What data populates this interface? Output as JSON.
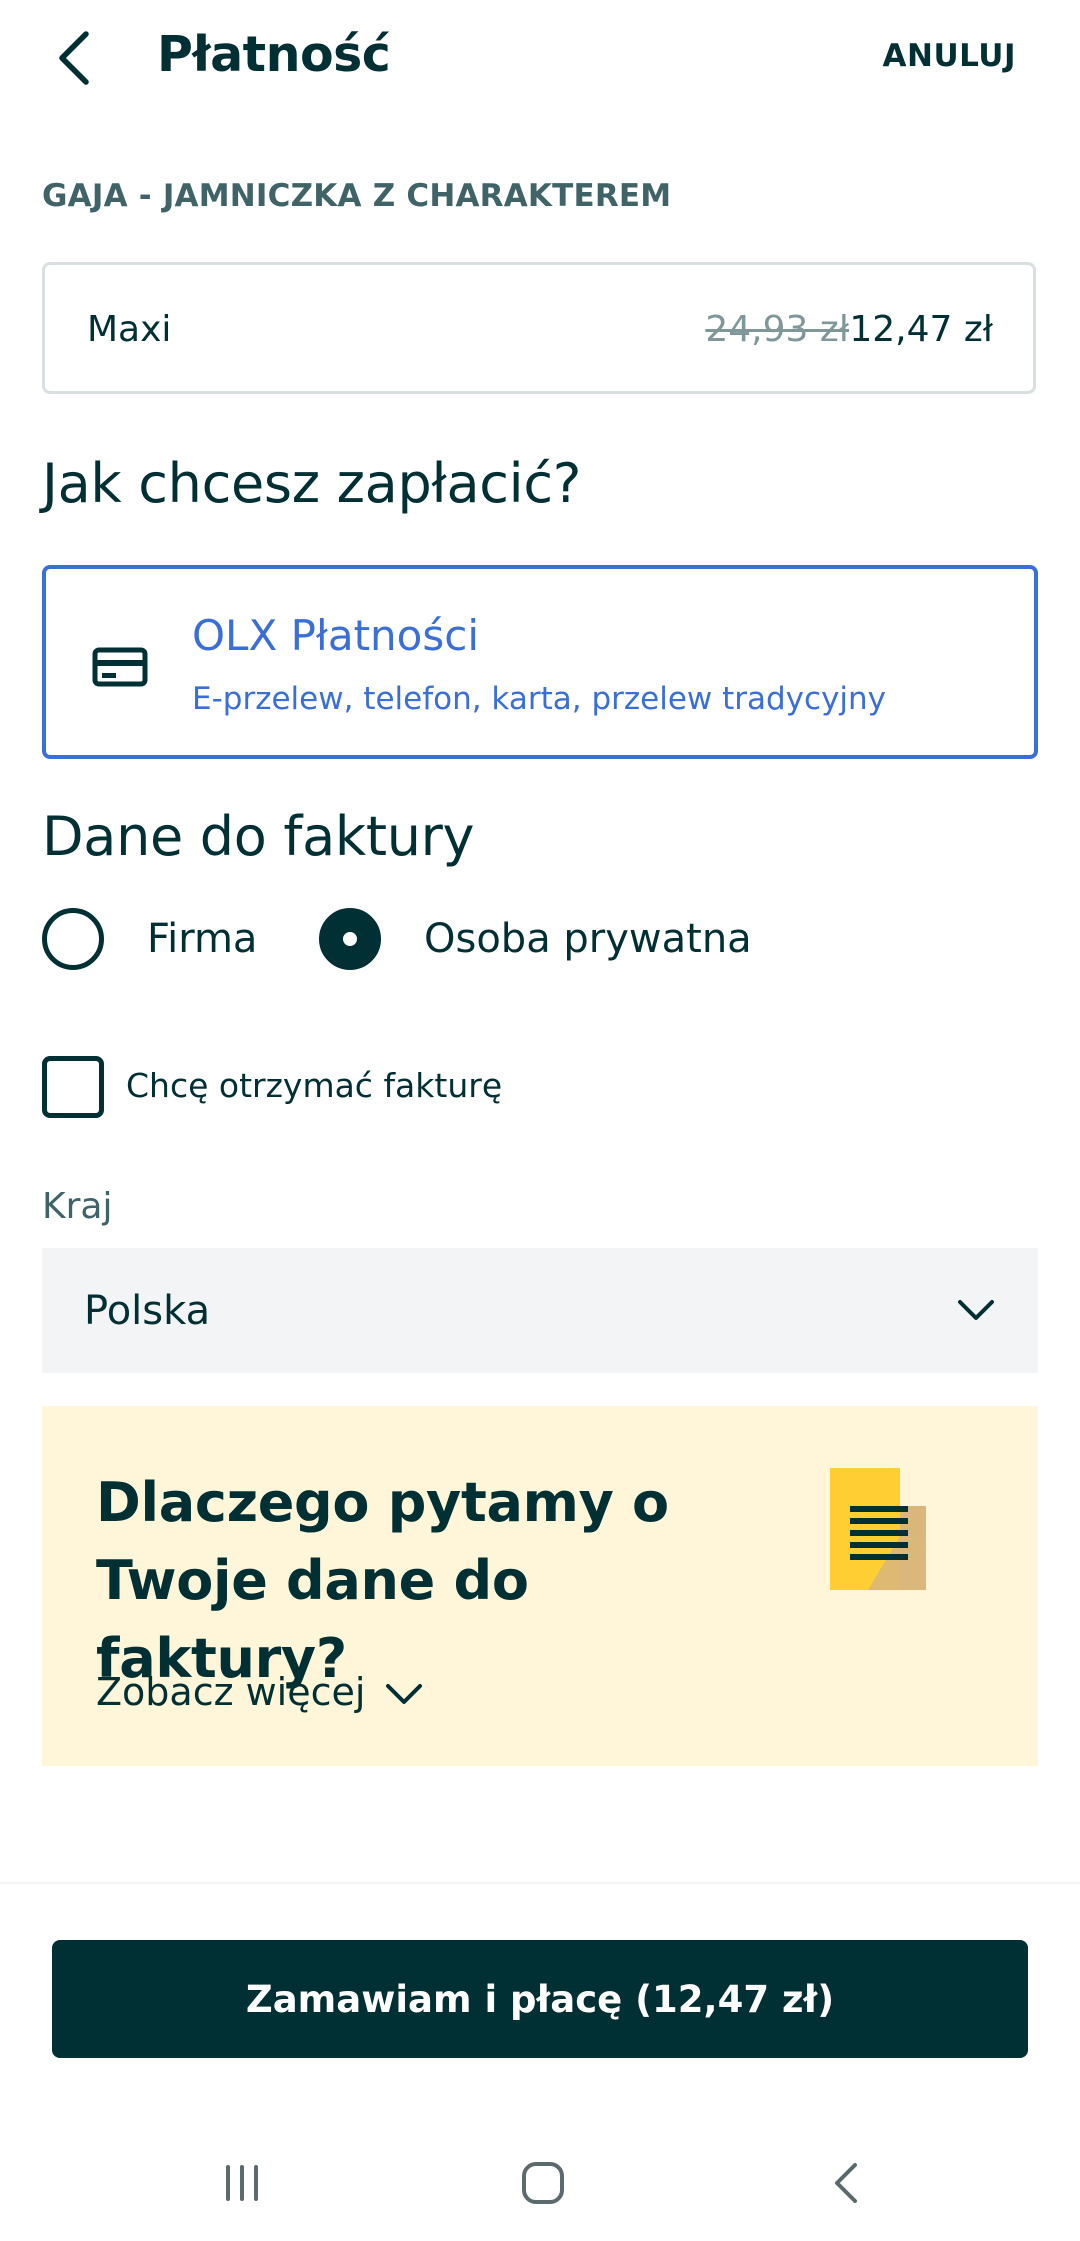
{
  "header": {
    "title": "Płatność",
    "cancel_label": "ANULUJ"
  },
  "ad": {
    "title": "GAJA - JAMNICZKA Z CHARAKTEREM"
  },
  "package": {
    "name": "Maxi",
    "old_price": "24,93 zł",
    "price": "12,47 zł"
  },
  "payment": {
    "heading": "Jak chcesz zapłacić?",
    "method_name": "OLX Płatności",
    "method_desc": "E-przelew, telefon, karta, przelew tradycyjny",
    "icon": "credit-card-icon",
    "accent": "#3a6fd8"
  },
  "invoice": {
    "heading": "Dane do faktury",
    "options": [
      {
        "label": "Firma",
        "selected": false
      },
      {
        "label": "Osoba prywatna",
        "selected": true
      }
    ],
    "checkbox_label": "Chcę otrzymać fakturę",
    "checkbox_checked": false,
    "country_label": "Kraj",
    "country_value": "Polska"
  },
  "info_card": {
    "title": "Dlaczego pytamy o Twoje dane do faktury?",
    "more_label": "Zobacz więcej",
    "background": "#fff6d9",
    "icon": "document-icon"
  },
  "submit": {
    "label": "Zamawiam i płacę (12,47 zł)",
    "color": "#002f34"
  },
  "system_nav": {
    "buttons": [
      "recent-apps-icon",
      "home-icon",
      "back-icon"
    ]
  }
}
